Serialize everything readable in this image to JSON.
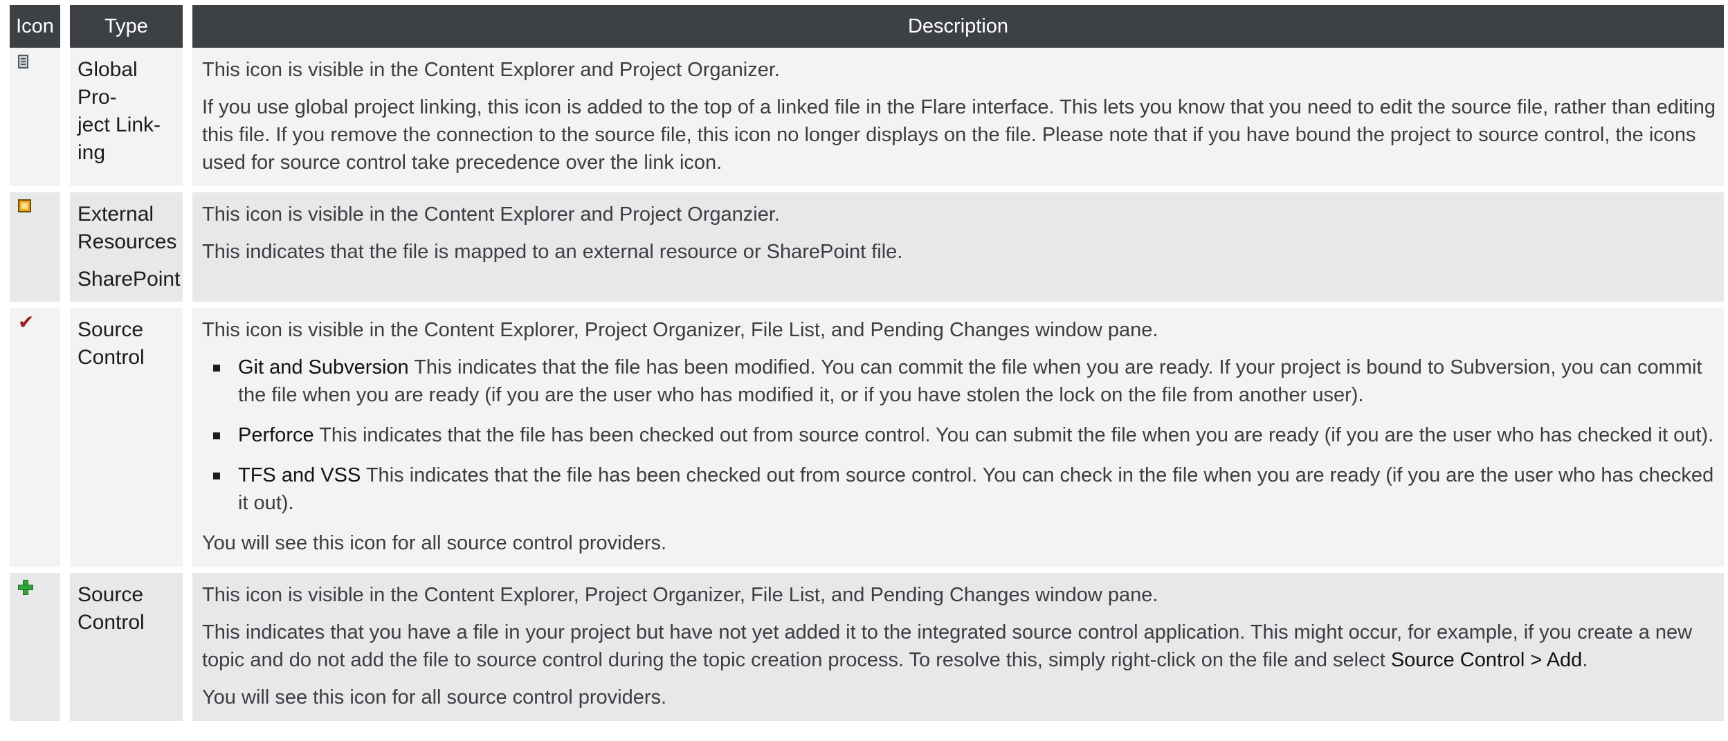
{
  "header": {
    "icon": "Icon",
    "type": "Type",
    "description": "Description"
  },
  "rows": [
    {
      "icon": "global-link-icon",
      "type": [
        "Global Pro-",
        "ject Link-",
        "ing"
      ],
      "desc": [
        "This icon is visible in the Content Explorer and Project Organizer.",
        "If you use global project linking, this icon is added to the top of a linked file in the Flare interface. This lets you know that you need to edit the source file, rather than editing this file. If you remove the connection to the source file, this icon no longer displays on the file. Please note that if you have bound the project to source control, the icons used for source control take precedence over the link icon."
      ]
    },
    {
      "icon": "external-resource-icon",
      "type": [
        "External Resources",
        "SharePoint"
      ],
      "desc": [
        "This icon is visible in the Content Explorer and Project Organzier.",
        "This indicates that the file is mapped to an external resource or SharePoint file."
      ]
    },
    {
      "icon": "checkmark-icon",
      "type": [
        "Source Control"
      ],
      "intro": "This icon is visible in the Content Explorer, Project Organizer, File List, and Pending Changes window pane.",
      "bullets": [
        {
          "term": "Git and Subversion",
          "text": " This indicates that the file has been modified. You can commit the file when you are ready. If your project is bound to Subversion, you can commit the file when you are ready (if you are the user who has modified it, or if you have stolen the lock on the file from another user)."
        },
        {
          "term": "Perforce",
          "text": " This indicates that the file has been checked out from source control. You can submit the file when you are ready (if you are the user who has checked it out)."
        },
        {
          "term": "TFS and VSS",
          "text": " This indicates that the file has been checked out from source control. You can check in the file when you are ready (if you are the user who has checked it out)."
        }
      ],
      "outro": "You will see this icon for all source control providers."
    },
    {
      "icon": "green-plus-icon",
      "type": [
        "Source Control"
      ],
      "desc1": "This icon is visible in the Content Explorer, Project Organizer, File List, and Pending Changes window pane.",
      "desc2_prefix": "This indicates that you have a file in your project but have not yet added it to the integrated source control application. This might occur, for example, if you create a new topic and do not add the file to source control during the topic creation process. To resolve this, simply right-click on the file and select ",
      "desc2_command": "Source Control > Add",
      "desc2_suffix": ".",
      "desc3": "You will see this icon for all source control providers."
    }
  ]
}
